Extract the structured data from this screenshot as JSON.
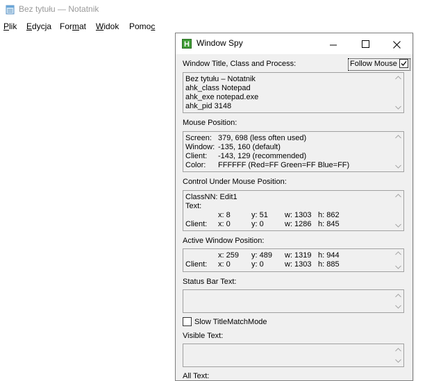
{
  "notepad": {
    "title": "Bez tytułu — Notatnik",
    "menu": [
      {
        "first": "P",
        "rest": "lik"
      },
      {
        "first": "E",
        "rest": "dycja"
      },
      {
        "first": "For",
        "mid": "m",
        "rest": "at"
      },
      {
        "first": "W",
        "rest": "idok"
      },
      {
        "first": "Pomo",
        "mid": "c",
        "rest": ""
      }
    ]
  },
  "spy": {
    "title": "Window Spy",
    "icon_letter": "H",
    "controls": {
      "minimize": "—",
      "close": "✕"
    },
    "follow_mouse": {
      "label": "Follow Mouse",
      "checked": true
    },
    "sections": {
      "title_class": {
        "label": "Window Title, Class and Process:",
        "lines": [
          "Bez tytułu – Notatnik",
          "ahk_class Notepad",
          "ahk_exe notepad.exe",
          "ahk_pid 3148"
        ]
      },
      "mouse": {
        "label": "Mouse Position:",
        "rows": [
          {
            "k": "Screen:",
            "v": "379, 698 (less often used)"
          },
          {
            "k": "Window:",
            "v": "-135, 160 (default)"
          },
          {
            "k": "Client:",
            "v": "-143, 129 (recommended)"
          },
          {
            "k": "Color:",
            "v": "FFFFFF (Red=FF Green=FF Blue=FF)"
          }
        ]
      },
      "control": {
        "label": "Control Under Mouse Position:",
        "classnn": "ClassNN: Edit1",
        "text": "Text:",
        "rows": [
          {
            "k": "",
            "x": "x: 8",
            "y": "y: 51",
            "w": "w: 1303",
            "h": "h: 862"
          },
          {
            "k": "Client:",
            "x": "x: 0",
            "y": "y: 0",
            "w": "w: 1286",
            "h": "h: 845"
          }
        ]
      },
      "active": {
        "label": "Active Window Position:",
        "rows": [
          {
            "k": "",
            "x": "x: 259",
            "y": "y: 489",
            "w": "w: 1319",
            "h": "h: 944"
          },
          {
            "k": "Client:",
            "x": "x: 0",
            "y": "y: 0",
            "w": "w: 1303",
            "h": "h: 885"
          }
        ]
      },
      "status": {
        "label": "Status Bar Text:"
      },
      "slow": {
        "label": "Slow TitleMatchMode",
        "checked": false
      },
      "visible": {
        "label": "Visible Text:"
      },
      "all": {
        "label": "All Text:"
      }
    }
  }
}
